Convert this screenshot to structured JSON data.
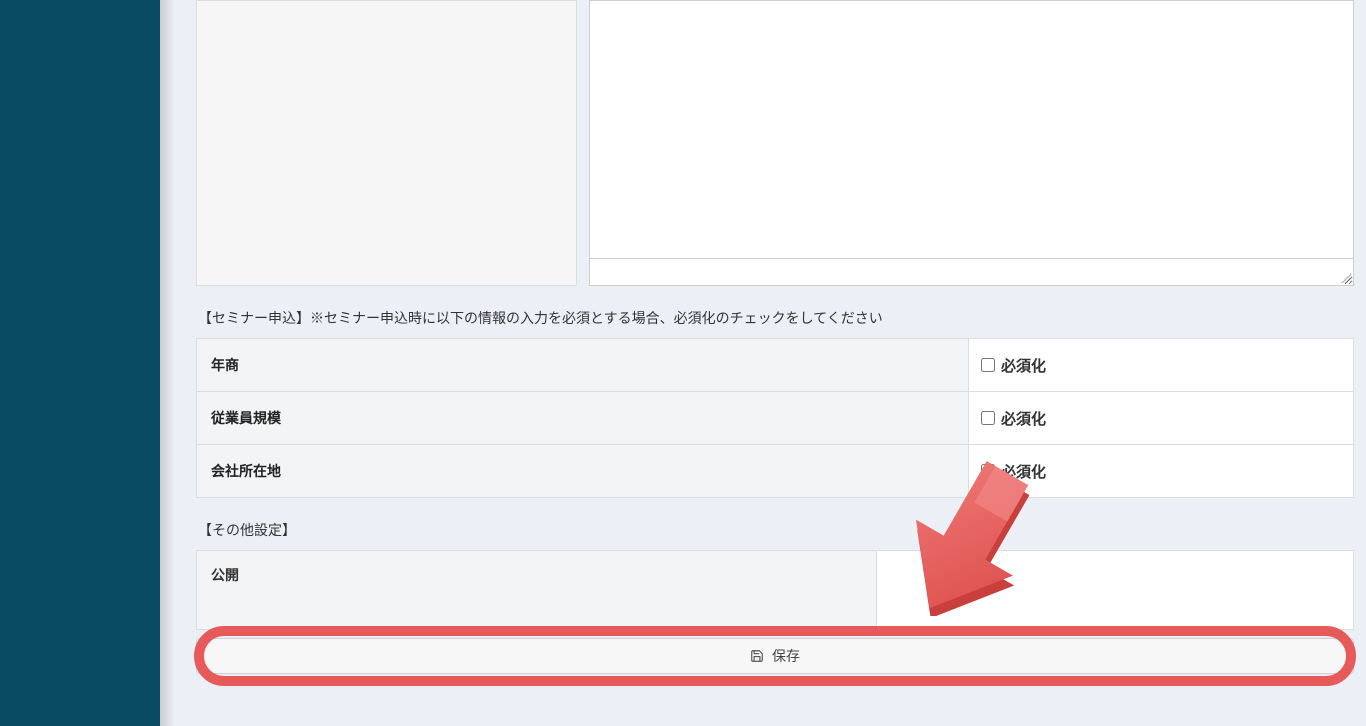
{
  "sections": {
    "seminar_note": "【セミナー申込】※セミナー申込時に以下の情報の入力を必須とする場合、必須化のチェックをしてください",
    "other_note": "【その他設定】"
  },
  "rows": [
    {
      "label": "年商",
      "req_label": "必須化"
    },
    {
      "label": "従業員規模",
      "req_label": "必須化"
    },
    {
      "label": "会社所在地",
      "req_label": "必須化"
    }
  ],
  "other": {
    "publish_label": "公開"
  },
  "buttons": {
    "save": "保存"
  },
  "colors": {
    "sidebar": "#0a4b64",
    "annotation": "#e75a5a"
  }
}
